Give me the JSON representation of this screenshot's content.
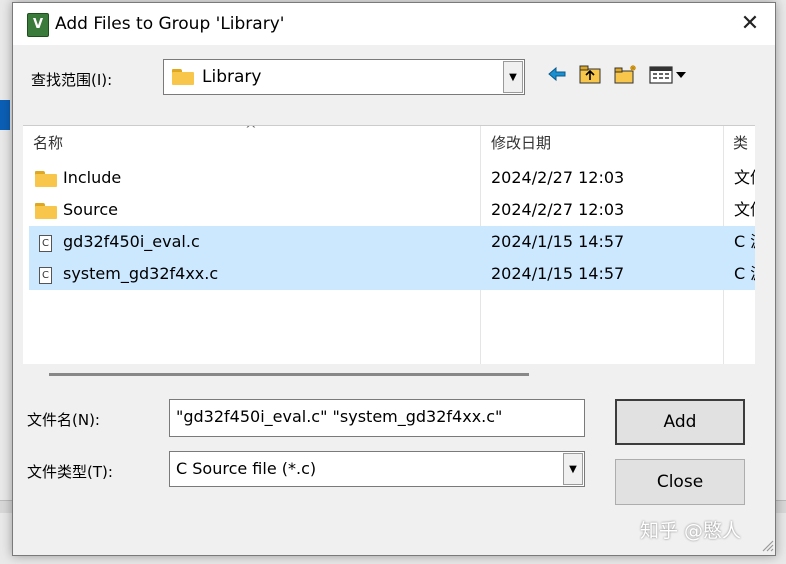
{
  "dialog": {
    "title": "Add Files to Group 'Library'",
    "app_icon": "V",
    "close_glyph": "✕"
  },
  "lookin": {
    "label": "查找范围(I):",
    "value": "Library"
  },
  "toolbar": {
    "icons": [
      "back-icon",
      "up-folder-icon",
      "new-folder-icon",
      "view-menu-icon"
    ]
  },
  "list": {
    "columns": [
      "名称",
      "修改日期",
      "类"
    ],
    "rows": [
      {
        "name": "Include",
        "date": "2024/2/27 12:03",
        "type": "文件",
        "kind": "folder",
        "selected": false
      },
      {
        "name": "Source",
        "date": "2024/2/27 12:03",
        "type": "文件",
        "kind": "folder",
        "selected": false
      },
      {
        "name": "gd32f450i_eval.c",
        "date": "2024/1/15 14:57",
        "type": "C 源",
        "kind": "c-file",
        "selected": true
      },
      {
        "name": "system_gd32f4xx.c",
        "date": "2024/1/15 14:57",
        "type": "C 源",
        "kind": "c-file",
        "selected": true
      }
    ]
  },
  "filename": {
    "label": "文件名(N):",
    "value": "\"gd32f450i_eval.c\" \"system_gd32f4xx.c\""
  },
  "filetype": {
    "label": "文件类型(T):",
    "value": "C Source file (*.c)"
  },
  "buttons": {
    "add": "Add",
    "close": "Close"
  },
  "watermark": "知乎 @愍人",
  "colors": {
    "selection": "#cce8ff",
    "folder": "#f7c64b",
    "toolbar_icon": "#1b8fd0"
  }
}
